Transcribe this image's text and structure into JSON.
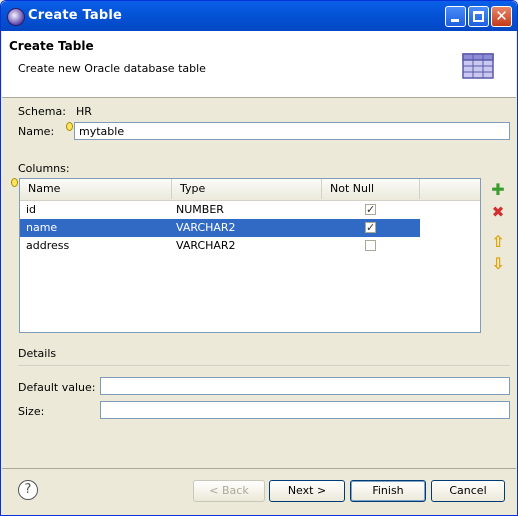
{
  "window": {
    "title": "Create Table"
  },
  "header": {
    "title": "Create Table",
    "description": "Create new Oracle database table"
  },
  "form": {
    "schema_label": "Schema:",
    "schema_value": "HR",
    "name_label": "Name:",
    "name_value": "mytable",
    "columns_label": "Columns:"
  },
  "columns_table": {
    "headers": [
      "Name",
      "Type",
      "Not Null"
    ],
    "rows": [
      {
        "name": "id",
        "type": "NUMBER",
        "not_null": true,
        "selected": false
      },
      {
        "name": "name",
        "type": "VARCHAR2",
        "not_null": true,
        "selected": true
      },
      {
        "name": "address",
        "type": "VARCHAR2",
        "not_null": false,
        "selected": false
      }
    ]
  },
  "side_buttons": [
    "add-icon",
    "delete-icon",
    "move-up-icon",
    "move-down-icon"
  ],
  "details": {
    "section_label": "Details",
    "default_value_label": "Default value:",
    "default_value": "",
    "size_label": "Size:",
    "size_value": ""
  },
  "footer": {
    "help_glyph": "?",
    "back_label": "< Back",
    "next_label": "Next >",
    "finish_label": "Finish",
    "cancel_label": "Cancel"
  },
  "colors": {
    "titlebar": "#0453d7",
    "selection": "#316ac5",
    "add": "#3a9b2e",
    "delete": "#d32f2f",
    "arrows": "#e0a000"
  }
}
